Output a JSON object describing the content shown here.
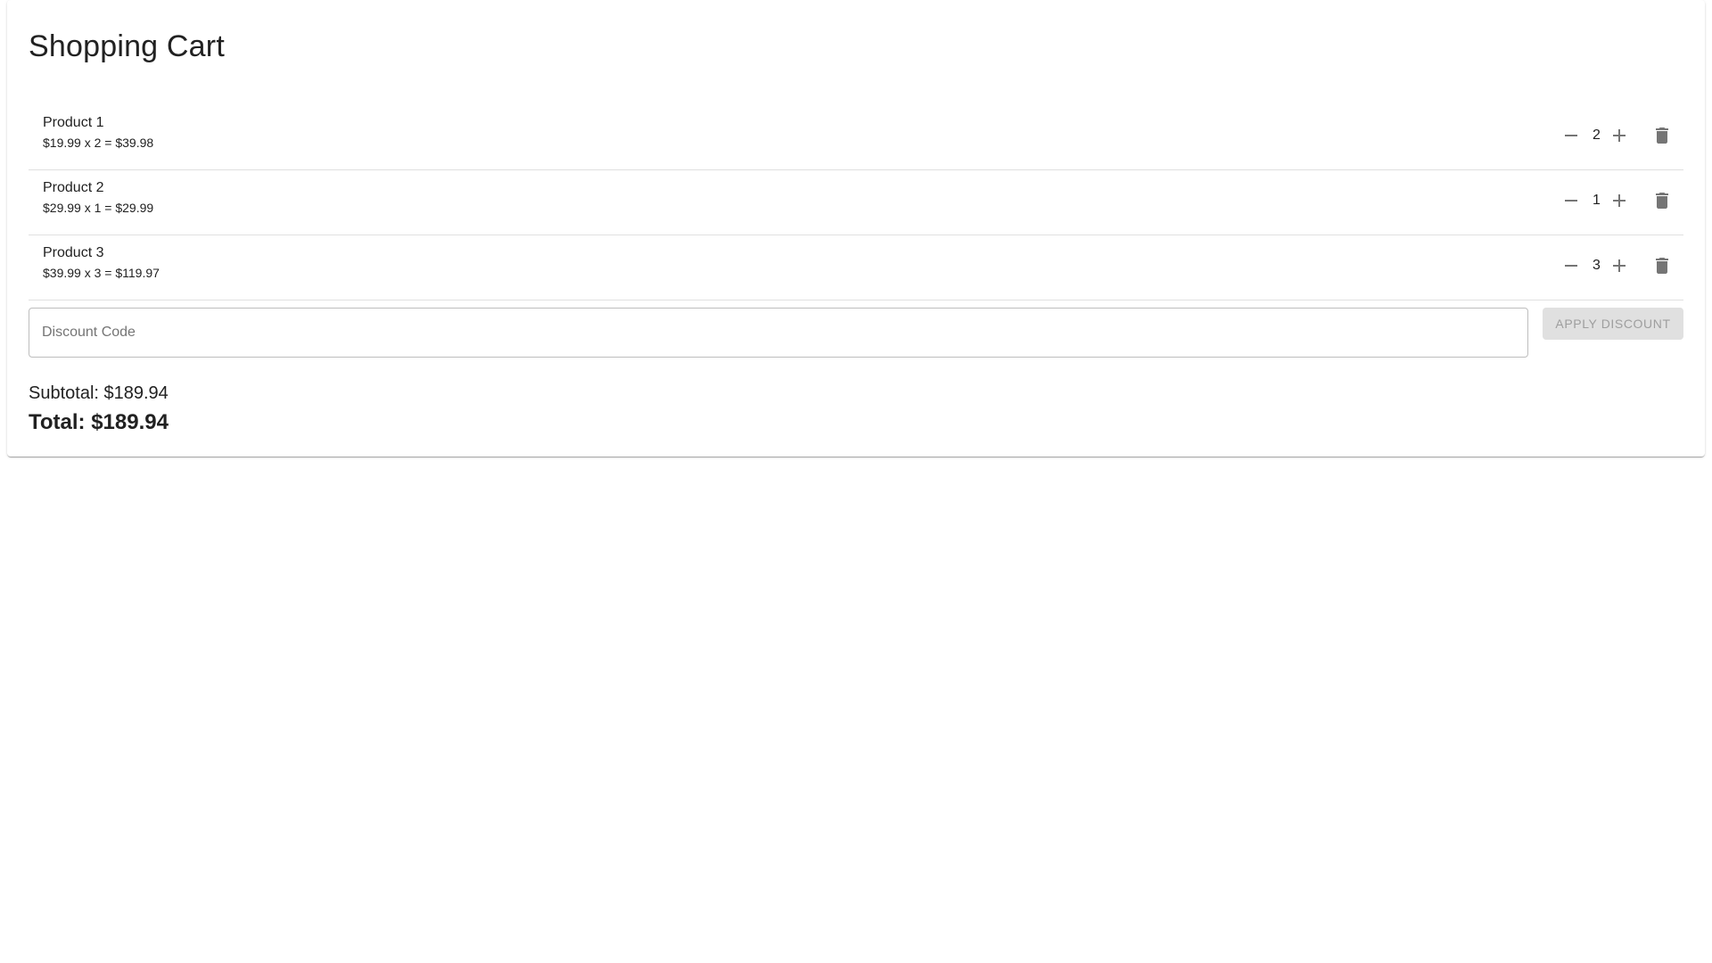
{
  "cart": {
    "title": "Shopping Cart",
    "items": [
      {
        "name": "Product 1",
        "detail": "$19.99 x 2 = $39.98",
        "quantity": "2"
      },
      {
        "name": "Product 2",
        "detail": "$29.99 x 1 = $29.99",
        "quantity": "1"
      },
      {
        "name": "Product 3",
        "detail": "$39.99 x 3 = $119.97",
        "quantity": "3"
      }
    ],
    "discount": {
      "placeholder": "Discount Code",
      "value": "",
      "apply_label": "Apply Discount"
    },
    "subtotal": "Subtotal: $189.94",
    "total": "Total: $189.94"
  },
  "icons": {
    "decrease": "minus-icon",
    "increase": "plus-icon",
    "delete": "trash-icon"
  },
  "colors": {
    "icon": "#757575",
    "divider": "#e0e0e0",
    "disabled_button_bg": "#e0e0e0",
    "disabled_button_text": "#9e9e9e",
    "text": "#212121"
  }
}
